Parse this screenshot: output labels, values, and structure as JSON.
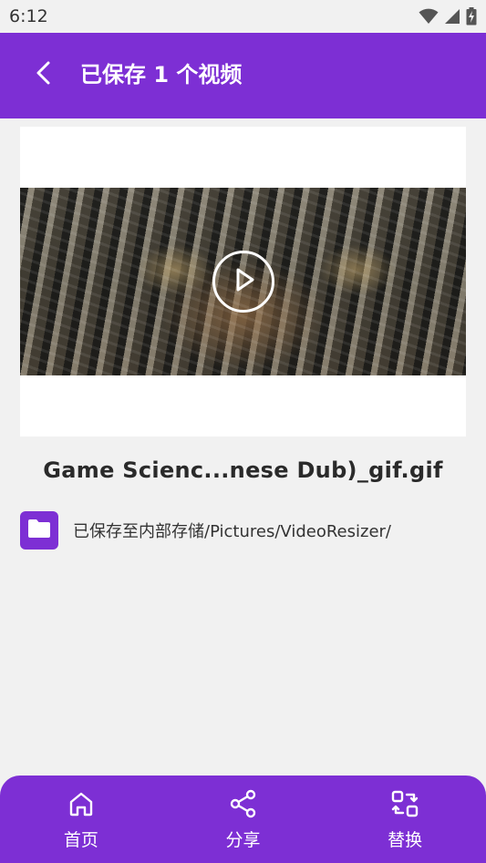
{
  "status_bar": {
    "time": "6:12",
    "icons": [
      "wifi-icon",
      "signal-icon",
      "battery-charging-icon"
    ]
  },
  "app_bar": {
    "title": "已保存 1 个视频",
    "back_icon": "back-arrow-icon"
  },
  "video": {
    "play_icon": "play-icon"
  },
  "file": {
    "name": "Game Scienc...nese Dub)_gif.gif",
    "saved_path": "已保存至内部存储/Pictures/VideoResizer/",
    "folder_icon": "folder-icon"
  },
  "bottom_nav": {
    "items": [
      {
        "label": "首页",
        "icon": "home-icon"
      },
      {
        "label": "分享",
        "icon": "share-icon"
      },
      {
        "label": "替换",
        "icon": "replace-icon"
      }
    ]
  },
  "colors": {
    "primary": "#7d2fd4",
    "background": "#f1f1f1",
    "card": "#ffffff"
  }
}
